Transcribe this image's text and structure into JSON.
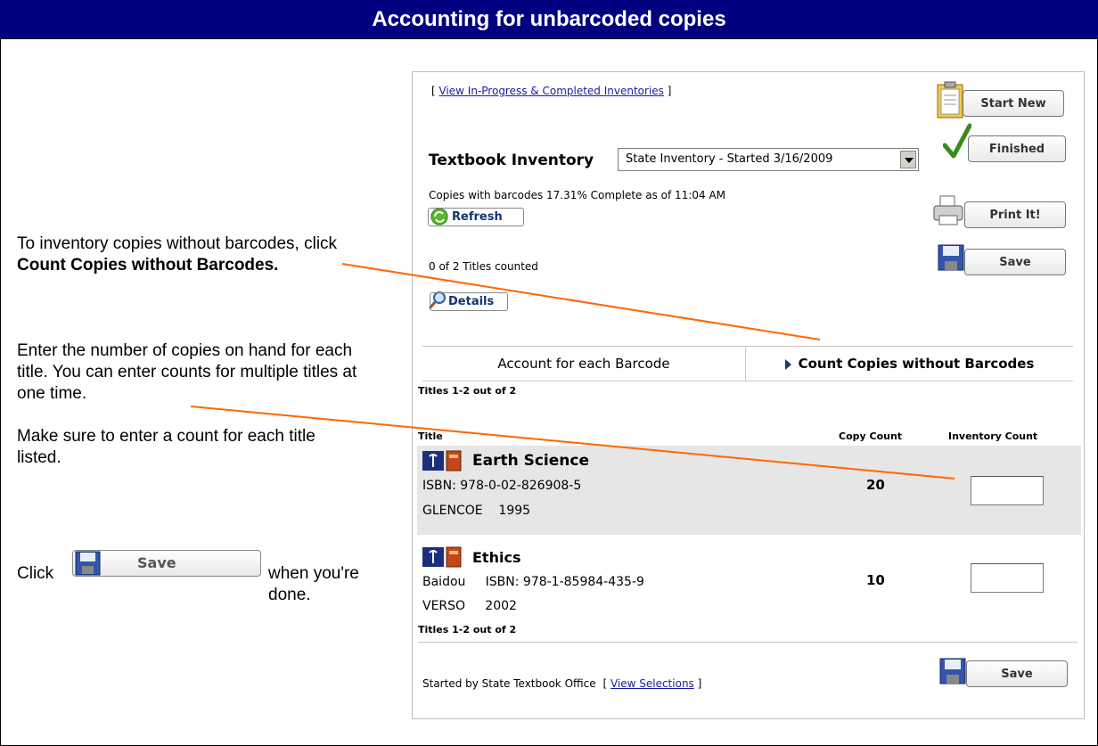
{
  "header": {
    "title": "Accounting for unbarcoded copies"
  },
  "instructions": {
    "p1_before": "To inventory copies without barcodes, click ",
    "p1_bold": "Count Copies without Barcodes.",
    "p2": "Enter the number of copies on hand for each title. You can enter counts for multiple titles at one time.",
    "p3": "Make sure to enter a count for each title listed.",
    "click_word": "Click",
    "save_label": "Save",
    "after_save": "when you're done."
  },
  "panel": {
    "view_inventories_link": "View In-Progress & Completed Inventories",
    "bracket_open": "[",
    "bracket_close": "]",
    "inventory_label": "Textbook Inventory",
    "inventory_selected": "State Inventory - Started 3/16/2009",
    "progress_text": "Copies with barcodes 17.31% Complete as of 11:04 AM",
    "refresh_label": "Refresh",
    "titles_counted": "0 of 2 Titles counted",
    "details_label": "Details",
    "buttons": {
      "start_new": "Start New",
      "finished": "Finished",
      "print_it": "Print It!",
      "save": "Save",
      "save_bottom": "Save"
    },
    "tabs": {
      "account_barcode": "Account for each Barcode",
      "count_copies": "Count Copies without Barcodes"
    },
    "titles_range_top": "Titles 1-2 out of 2",
    "titles_range_bottom": "Titles 1-2 out of 2",
    "columns": {
      "title": "Title",
      "copy_count": "Copy Count",
      "inventory_count": "Inventory Count"
    },
    "rows": [
      {
        "title": "Earth Science",
        "line2": "ISBN: 978-0-02-826908-5",
        "line3": "GLENCOE    1995",
        "copy_count": "20",
        "inventory_count": ""
      },
      {
        "title": "Ethics",
        "line2": "Baidou     ISBN: 978-1-85984-435-9",
        "line3": "VERSO     2002",
        "copy_count": "10",
        "inventory_count": ""
      }
    ],
    "started_by": "Started by State Textbook Office",
    "view_selections_link": "View Selections"
  },
  "colors": {
    "header_bg": "#000080",
    "callout_line": "#ff6600",
    "row_highlight": "#e6e6e6"
  },
  "icons": [
    "clipboard-icon",
    "checkmark-icon",
    "refresh-icon",
    "printer-icon",
    "floppy-disk-icon",
    "magnifier-icon",
    "tab-arrow-icon",
    "state-flag-icon",
    "book-icon"
  ]
}
